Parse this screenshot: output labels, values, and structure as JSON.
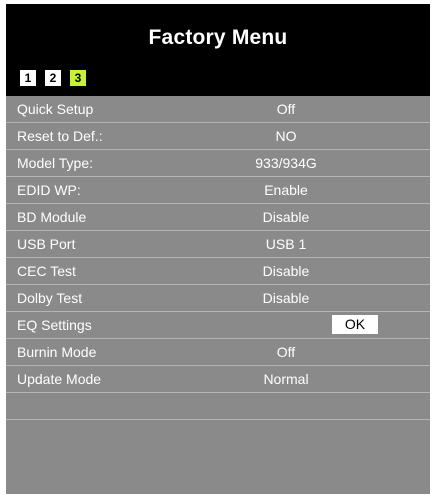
{
  "menu": {
    "title": "Factory Menu",
    "pages": [
      "1",
      "2",
      "3"
    ],
    "active_page": "3",
    "active_color": "#c8f23a"
  },
  "settings": [
    {
      "label": "Quick Setup",
      "value": "Off"
    },
    {
      "label": "Reset to Def.:",
      "value": "NO"
    },
    {
      "label": "Model Type:",
      "value": "933/934G"
    },
    {
      "label": "EDID WP:",
      "value": "Enable"
    },
    {
      "label": "BD Module",
      "value": "Disable"
    },
    {
      "label": "USB Port",
      "value": "USB 1"
    },
    {
      "label": "CEC Test",
      "value": "Disable"
    },
    {
      "label": "Dolby Test",
      "value": "Disable"
    },
    {
      "label": "EQ Settings",
      "value": "OK",
      "selected": true
    },
    {
      "label": "Burnin Mode",
      "value": "Off"
    },
    {
      "label": "Update Mode",
      "value": "Normal"
    }
  ]
}
